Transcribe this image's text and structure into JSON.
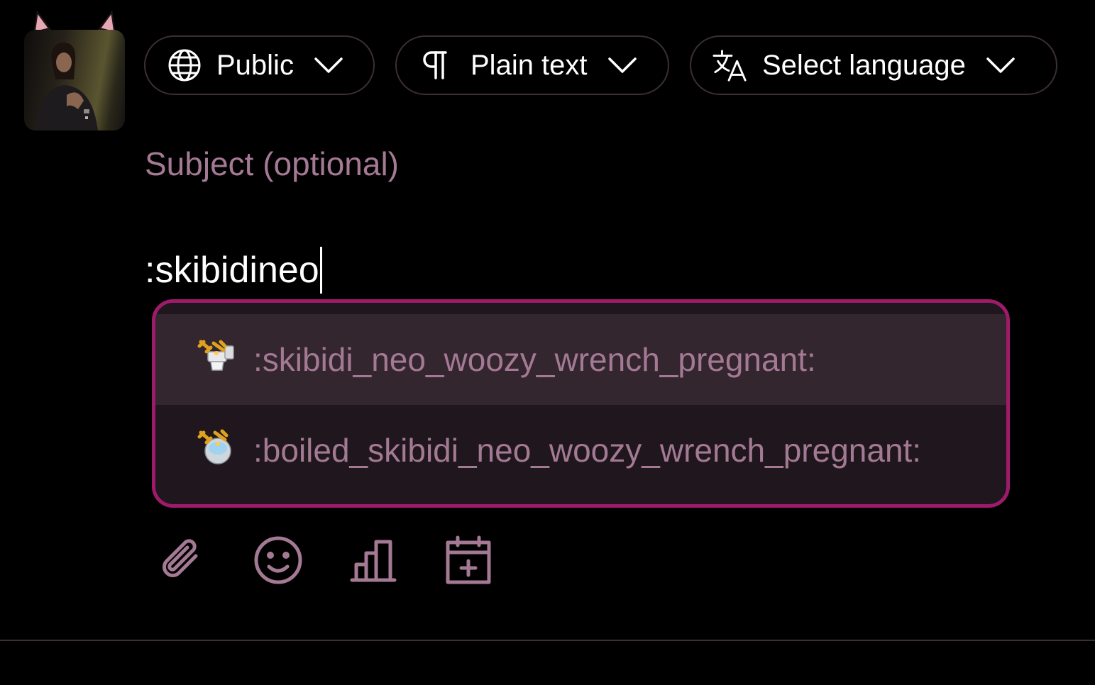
{
  "colors": {
    "accent": "#a01a6a",
    "muted_text": "#a47994",
    "border": "#3b2f34",
    "dropdown_bg": "#1f171d",
    "dropdown_selected_bg": "#33262f"
  },
  "avatar": {
    "icon": "cat-ear-avatar"
  },
  "compose": {
    "visibility": {
      "label": "Public",
      "icon": "globe-icon"
    },
    "format": {
      "label": "Plain text",
      "icon": "pilcrow-icon"
    },
    "language": {
      "label": "Select language",
      "icon": "translate-icon"
    },
    "subject_placeholder": "Subject (optional)",
    "subject_value": "",
    "status_text": ":skibidineo"
  },
  "suggestions": [
    {
      "shortcode": ":skibidi_neo_woozy_wrench_pregnant:",
      "icon": "toilet-wrench-emoji",
      "selected": true
    },
    {
      "shortcode": ":boiled_skibidi_neo_woozy_wrench_pregnant:",
      "icon": "boiled-wrench-emoji",
      "selected": false
    }
  ],
  "toolbar": [
    {
      "name": "attach",
      "icon": "paperclip-icon"
    },
    {
      "name": "emoji",
      "icon": "smiley-icon"
    },
    {
      "name": "poll",
      "icon": "bar-chart-icon"
    },
    {
      "name": "schedule",
      "icon": "calendar-plus-icon"
    }
  ]
}
